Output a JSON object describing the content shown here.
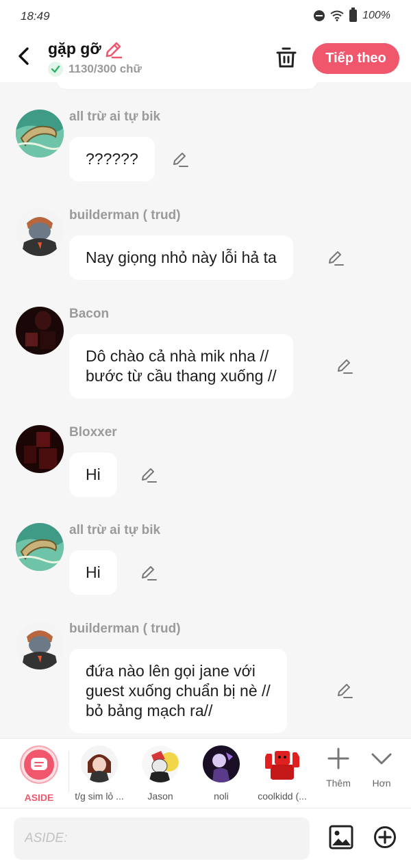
{
  "status_bar": {
    "time": "18:49",
    "battery": "100%"
  },
  "header": {
    "title": "gặp gỡ",
    "char_count": "1130/300 chữ",
    "next_label": "Tiếp theo"
  },
  "messages": [
    {
      "sender": "all trừ ai tự bik",
      "text": "??????"
    },
    {
      "sender": "builderman ( trud)",
      "text": "Nay giọng nhỏ này lỗi hả ta"
    },
    {
      "sender": "Bacon",
      "text": "Dô chào cả nhà mik nha //\nbước từ cầu thang xuống //"
    },
    {
      "sender": "Bloxxer",
      "text": "Hi"
    },
    {
      "sender": "all trừ ai tự bik",
      "text": "Hi"
    },
    {
      "sender": "builderman ( trud)",
      "text": "đứa nào lên gọi jane với\nguest xuống chuẩn bị nè //\nbỏ bảng mạch ra//"
    }
  ],
  "characters": [
    {
      "label": "ASIDE"
    },
    {
      "label": "t/g sim lỏ ..."
    },
    {
      "label": "Jason"
    },
    {
      "label": "noli"
    },
    {
      "label": "coolkidd (..."
    }
  ],
  "tools": {
    "add_label": "Thêm",
    "more_label": "Hơn"
  },
  "input": {
    "placeholder": "ASIDE:"
  },
  "colors": {
    "accent": "#f0566c",
    "check": "#2fb36a"
  }
}
